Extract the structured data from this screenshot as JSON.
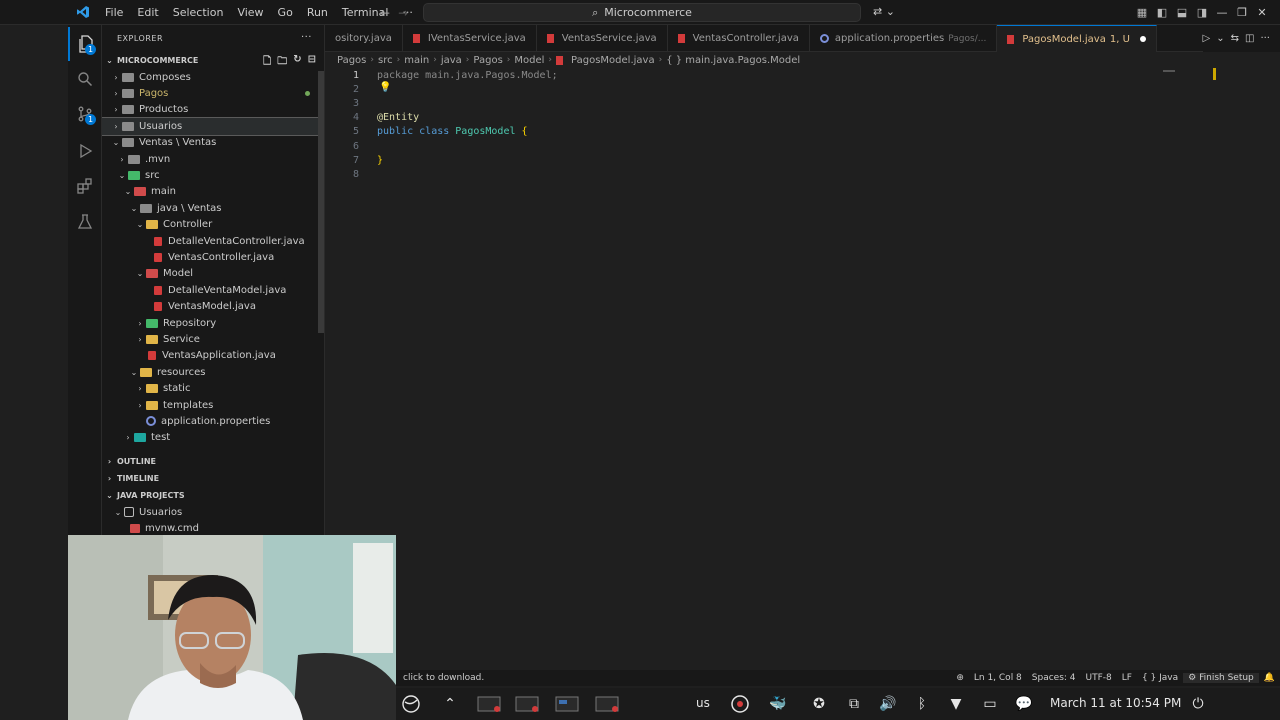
{
  "titlebar": {
    "menu": [
      "File",
      "Edit",
      "Selection",
      "View",
      "Go",
      "Run",
      "Terminal",
      "···"
    ],
    "search_text": "Microcommerce"
  },
  "activitybar": {
    "items": [
      {
        "icon": "files-icon",
        "badge": "1"
      },
      {
        "icon": "search-icon"
      },
      {
        "icon": "source-control-icon",
        "badge": "1"
      },
      {
        "icon": "run-debug-icon"
      },
      {
        "icon": "extensions-icon"
      },
      {
        "icon": "testing-icon"
      }
    ]
  },
  "sidebar": {
    "title": "EXPLORER",
    "more": "···",
    "workspace": "MICROCOMMERCE",
    "tree": [
      {
        "label": "Composes",
        "depth": 0,
        "chev": "›",
        "icon": "gray"
      },
      {
        "label": "Pagos",
        "depth": 0,
        "chev": "›",
        "icon": "gray",
        "modified": true
      },
      {
        "label": "Productos",
        "depth": 0,
        "chev": "›",
        "icon": "gray"
      },
      {
        "label": "Usuarios",
        "depth": 0,
        "chev": "›",
        "icon": "gray",
        "selected": true
      },
      {
        "label": "Ventas \\ Ventas",
        "depth": 0,
        "chev": "⌄",
        "icon": "gray"
      },
      {
        "label": ".mvn",
        "depth": 1,
        "chev": "›",
        "icon": "gray"
      },
      {
        "label": "src",
        "depth": 1,
        "chev": "⌄",
        "icon": "green"
      },
      {
        "label": "main",
        "depth": 2,
        "chev": "⌄",
        "icon": "red"
      },
      {
        "label": "java \\ Ventas",
        "depth": 3,
        "chev": "⌄",
        "icon": "gray"
      },
      {
        "label": "Controller",
        "depth": 4,
        "chev": "⌄",
        "icon": "yellow"
      },
      {
        "label": "DetalleVentaController.java",
        "depth": 5,
        "chev": "",
        "icon": "java"
      },
      {
        "label": "VentasController.java",
        "depth": 5,
        "chev": "",
        "icon": "java"
      },
      {
        "label": "Model",
        "depth": 4,
        "chev": "⌄",
        "icon": "red"
      },
      {
        "label": "DetalleVentaModel.java",
        "depth": 5,
        "chev": "",
        "icon": "java"
      },
      {
        "label": "VentasModel.java",
        "depth": 5,
        "chev": "",
        "icon": "java"
      },
      {
        "label": "Repository",
        "depth": 4,
        "chev": "›",
        "icon": "green"
      },
      {
        "label": "Service",
        "depth": 4,
        "chev": "›",
        "icon": "yellow"
      },
      {
        "label": "VentasApplication.java",
        "depth": 4,
        "chev": "",
        "icon": "java"
      },
      {
        "label": "resources",
        "depth": 3,
        "chev": "⌄",
        "icon": "yellow"
      },
      {
        "label": "static",
        "depth": 4,
        "chev": "›",
        "icon": "yellow"
      },
      {
        "label": "templates",
        "depth": 4,
        "chev": "›",
        "icon": "yellow"
      },
      {
        "label": "application.properties",
        "depth": 4,
        "chev": "",
        "icon": "gear"
      },
      {
        "label": "test",
        "depth": 2,
        "chev": "›",
        "icon": "teal"
      }
    ],
    "outline": "OUTLINE",
    "timeline": "TIMELINE",
    "java_projects": "JAVA PROJECTS",
    "java_projects_items": [
      {
        "label": "Usuarios",
        "chev": "⌄"
      },
      {
        "label": "mvnw.cmd",
        "chev": ""
      }
    ]
  },
  "tabs": [
    {
      "label": "ository.java",
      "icon": "none",
      "active": false
    },
    {
      "label": "IVentasService.java",
      "icon": "java",
      "active": false
    },
    {
      "label": "VentasService.java",
      "icon": "java",
      "active": false
    },
    {
      "label": "VentasController.java",
      "icon": "java",
      "active": false
    },
    {
      "label": "application.properties",
      "sub": "Pagos/...",
      "icon": "gear",
      "active": false
    },
    {
      "label": "PagosModel.java",
      "sub": "1, U",
      "icon": "java",
      "active": true
    }
  ],
  "breadcrumb": [
    "Pagos",
    "src",
    "main",
    "java",
    "Pagos",
    "Model",
    "PagosModel.java",
    "{ } main.java.Pagos.Model"
  ],
  "editor": {
    "lines": [
      {
        "n": "1",
        "tokens": [
          {
            "t": "package ",
            "c": "dimtext"
          },
          {
            "t": "main.java.Pagos.Model;",
            "c": "dimtext"
          }
        ]
      },
      {
        "n": "2",
        "tokens": []
      },
      {
        "n": "3",
        "tokens": []
      },
      {
        "n": "4",
        "tokens": [
          {
            "t": "@Entity",
            "c": "an"
          }
        ]
      },
      {
        "n": "5",
        "tokens": [
          {
            "t": "public ",
            "c": "kw"
          },
          {
            "t": "class ",
            "c": "kw"
          },
          {
            "t": "PagosModel ",
            "c": "ty"
          },
          {
            "t": "{",
            "c": "br"
          }
        ]
      },
      {
        "n": "6",
        "tokens": []
      },
      {
        "n": "7",
        "tokens": [
          {
            "t": "}",
            "c": "br"
          }
        ]
      },
      {
        "n": "8",
        "tokens": []
      }
    ]
  },
  "statusbar": {
    "left": "click to download.",
    "position": "Ln 1, Col 8",
    "spaces": "Spaces: 4",
    "encoding": "UTF-8",
    "eol": "LF",
    "language": "{ } Java",
    "finish_setup": "Finish Setup"
  },
  "taskbar": {
    "keyboard": "us",
    "datetime": "March 11 at 10:54 PM"
  }
}
